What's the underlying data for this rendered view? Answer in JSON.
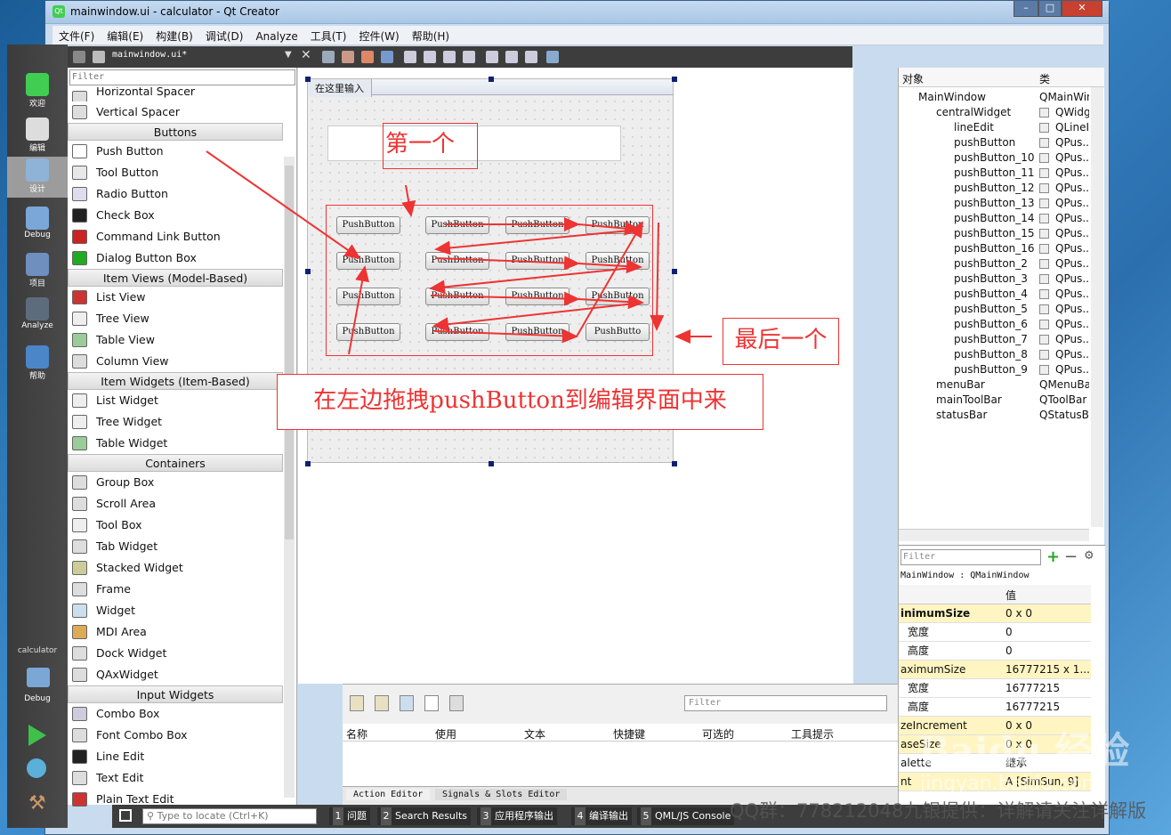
{
  "window": {
    "title": "mainwindow.ui - calculator - Qt Creator",
    "min": "–",
    "max": "□",
    "close": "✕"
  },
  "menu": [
    "文件(F)",
    "编辑(E)",
    "构建(B)",
    "调试(D)",
    "Analyze",
    "工具(T)",
    "控件(W)",
    "帮助(H)"
  ],
  "modes": [
    {
      "label": "欢迎",
      "icon": "qt-logo-icon",
      "selected": false
    },
    {
      "label": "编辑",
      "icon": "edit-document-icon",
      "selected": false
    },
    {
      "label": "设计",
      "icon": "design-pen-icon",
      "selected": true
    },
    {
      "label": "Debug",
      "icon": "debug-bug-icon",
      "selected": false
    },
    {
      "label": "项目",
      "icon": "project-wrench-icon",
      "selected": false
    },
    {
      "label": "Analyze",
      "icon": "analyze-monitor-icon",
      "selected": false
    },
    {
      "label": "帮助",
      "icon": "help-icon",
      "selected": false
    }
  ],
  "kit": {
    "project": "calculator",
    "mode": "Debug"
  },
  "toolbar": {
    "file": "mainwindow.ui*"
  },
  "widgetbox": {
    "filter_placeholder": "Filter",
    "items": [
      {
        "type": "item",
        "label": "Horizontal Spacer"
      },
      {
        "type": "item",
        "label": "Vertical Spacer"
      },
      {
        "type": "cat",
        "label": "Buttons"
      },
      {
        "type": "item",
        "label": "Push Button"
      },
      {
        "type": "item",
        "label": "Tool Button"
      },
      {
        "type": "item",
        "label": "Radio Button"
      },
      {
        "type": "item",
        "label": "Check Box"
      },
      {
        "type": "item",
        "label": "Command Link Button"
      },
      {
        "type": "item",
        "label": "Dialog Button Box"
      },
      {
        "type": "cat",
        "label": "Item Views (Model-Based)"
      },
      {
        "type": "item",
        "label": "List View"
      },
      {
        "type": "item",
        "label": "Tree View"
      },
      {
        "type": "item",
        "label": "Table View"
      },
      {
        "type": "item",
        "label": "Column View"
      },
      {
        "type": "cat",
        "label": "Item Widgets (Item-Based)"
      },
      {
        "type": "item",
        "label": "List Widget"
      },
      {
        "type": "item",
        "label": "Tree Widget"
      },
      {
        "type": "item",
        "label": "Table Widget"
      },
      {
        "type": "cat",
        "label": "Containers"
      },
      {
        "type": "item",
        "label": "Group Box"
      },
      {
        "type": "item",
        "label": "Scroll Area"
      },
      {
        "type": "item",
        "label": "Tool Box"
      },
      {
        "type": "item",
        "label": "Tab Widget"
      },
      {
        "type": "item",
        "label": "Stacked Widget"
      },
      {
        "type": "item",
        "label": "Frame"
      },
      {
        "type": "item",
        "label": "Widget"
      },
      {
        "type": "item",
        "label": "MDI Area"
      },
      {
        "type": "item",
        "label": "Dock Widget"
      },
      {
        "type": "item",
        "label": "QAxWidget"
      },
      {
        "type": "cat",
        "label": "Input Widgets"
      },
      {
        "type": "item",
        "label": "Combo Box"
      },
      {
        "type": "item",
        "label": "Font Combo Box"
      },
      {
        "type": "item",
        "label": "Line Edit"
      },
      {
        "type": "item",
        "label": "Text Edit"
      },
      {
        "type": "item",
        "label": "Plain Text Edit"
      }
    ]
  },
  "form": {
    "menu_placeholder": "在这里输入",
    "button_label": "PushButton",
    "button_label_last": "PushButto",
    "ann_first": "第一个",
    "ann_last": "最后一个",
    "ann_drag": "在左边拖拽pushButton到编辑界面中来"
  },
  "action_editor": {
    "filter": "Filter",
    "columns": [
      "名称",
      "使用",
      "文本",
      "快捷键",
      "可选的",
      "工具提示"
    ],
    "tabs": [
      "Action Editor",
      "Signals & Slots Editor"
    ]
  },
  "object_inspector": {
    "headers": [
      "对象",
      "类"
    ],
    "rows": [
      {
        "name": "MainWindow",
        "cls": "QMainWin",
        "indent": 0
      },
      {
        "name": "centralWidget",
        "cls": "QWidg",
        "indent": 1
      },
      {
        "name": "lineEdit",
        "cls": "QLineI",
        "indent": 2
      },
      {
        "name": "pushButton",
        "cls": "QPus..",
        "indent": 2
      },
      {
        "name": "pushButton_10",
        "cls": "QPus..",
        "indent": 2
      },
      {
        "name": "pushButton_11",
        "cls": "QPus..",
        "indent": 2
      },
      {
        "name": "pushButton_12",
        "cls": "QPus..",
        "indent": 2
      },
      {
        "name": "pushButton_13",
        "cls": "QPus..",
        "indent": 2
      },
      {
        "name": "pushButton_14",
        "cls": "QPus..",
        "indent": 2
      },
      {
        "name": "pushButton_15",
        "cls": "QPus..",
        "indent": 2
      },
      {
        "name": "pushButton_16",
        "cls": "QPus..",
        "indent": 2
      },
      {
        "name": "pushButton_2",
        "cls": "QPus..",
        "indent": 2
      },
      {
        "name": "pushButton_3",
        "cls": "QPus..",
        "indent": 2
      },
      {
        "name": "pushButton_4",
        "cls": "QPus..",
        "indent": 2
      },
      {
        "name": "pushButton_5",
        "cls": "QPus..",
        "indent": 2
      },
      {
        "name": "pushButton_6",
        "cls": "QPus..",
        "indent": 2
      },
      {
        "name": "pushButton_7",
        "cls": "QPus..",
        "indent": 2
      },
      {
        "name": "pushButton_8",
        "cls": "QPus..",
        "indent": 2
      },
      {
        "name": "pushButton_9",
        "cls": "QPus..",
        "indent": 2
      },
      {
        "name": "menuBar",
        "cls": "QMenuBa",
        "indent": 1
      },
      {
        "name": "mainToolBar",
        "cls": "QToolBar",
        "indent": 1
      },
      {
        "name": "statusBar",
        "cls": "QStatusBa",
        "indent": 1
      }
    ]
  },
  "property_editor": {
    "filter": "Filter",
    "class_line": "MainWindow : QMainWindow",
    "value_header": "值",
    "rows": [
      {
        "k": "inimumSize",
        "v": "0 x 0",
        "yel": true,
        "bold": true
      },
      {
        "k": "宽度",
        "v": "0",
        "yel": false,
        "sub": true
      },
      {
        "k": "高度",
        "v": "0",
        "yel": false,
        "sub": true
      },
      {
        "k": "aximumSize",
        "v": "16777215 x 1...",
        "yel": true
      },
      {
        "k": "宽度",
        "v": "16777215",
        "yel": false,
        "sub": true
      },
      {
        "k": "高度",
        "v": "16777215",
        "yel": false,
        "sub": true
      },
      {
        "k": "zeIncrement",
        "v": "0 x 0",
        "yel": true
      },
      {
        "k": "aseSize",
        "v": "0 x 0",
        "yel": true
      },
      {
        "k": "alette",
        "v": "继承",
        "yel": false
      },
      {
        "k": "nt",
        "v": "A  [SimSun, 9]",
        "yel": true
      }
    ]
  },
  "status": {
    "locate_placeholder": "Type to locate (Ctrl+K)",
    "tabs": [
      {
        "n": "1",
        "label": "问题"
      },
      {
        "n": "2",
        "label": "Search Results"
      },
      {
        "n": "3",
        "label": "应用程序输出"
      },
      {
        "n": "4",
        "label": "编译输出"
      },
      {
        "n": "5",
        "label": "QML/JS Console"
      }
    ]
  },
  "overlay": {
    "qq": "QQ群：778212048九银提供：详解请关注详解版",
    "baidu": "Baidu 经验",
    "baidu_url": "jingyan.baidu.com"
  }
}
